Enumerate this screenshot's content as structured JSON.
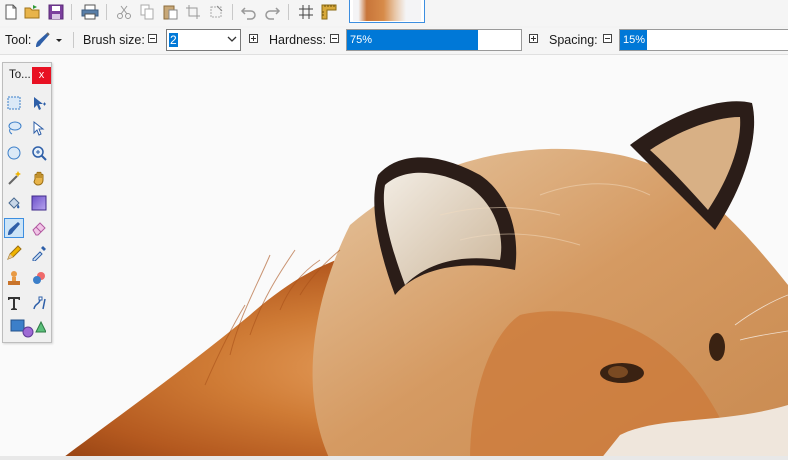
{
  "main_toolbar": {
    "buttons": [
      "new-file-icon",
      "open-file-icon",
      "save-icon",
      "print-icon",
      "cut-icon",
      "copy-icon",
      "paste-icon",
      "crop-icon",
      "deselect-icon",
      "undo-icon",
      "redo-icon",
      "grid-icon",
      "ruler-icon"
    ]
  },
  "tool_options": {
    "tool_label": "Tool:",
    "brush_size_label": "Brush size:",
    "brush_size_value": "2",
    "hardness_label": "Hardness:",
    "hardness_value": "75%",
    "hardness_fraction": 0.75,
    "spacing_label": "Spacing:",
    "spacing_value": "15%",
    "spacing_fraction": 0.15
  },
  "tools_window": {
    "title": "To...",
    "close_label": "x",
    "tools": [
      [
        "rectangle-select-icon",
        "move-selected-pixels-icon"
      ],
      [
        "lasso-select-icon",
        "move-selection-icon"
      ],
      [
        "ellipse-select-icon",
        "zoom-icon"
      ],
      [
        "magic-wand-icon",
        "pan-icon"
      ],
      [
        "paint-bucket-icon",
        "gradient-icon"
      ],
      [
        "paintbrush-icon",
        "eraser-icon"
      ],
      [
        "pencil-icon",
        "color-picker-icon"
      ],
      [
        "clone-stamp-icon",
        "recolor-icon"
      ],
      [
        "text-icon",
        "line-curve-icon"
      ],
      [
        "shapes-icon",
        ""
      ]
    ],
    "active_tool": "paintbrush-icon"
  },
  "colors": {
    "accent": "#0078d7",
    "close": "#e81123"
  }
}
